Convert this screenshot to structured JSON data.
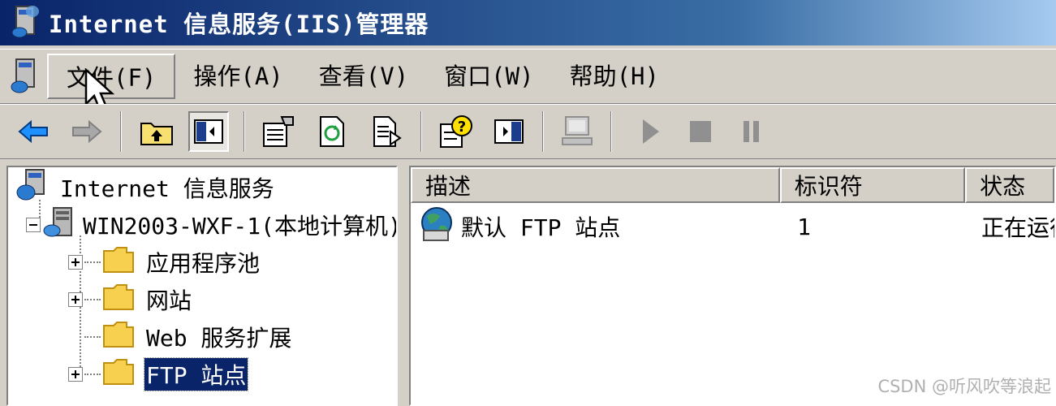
{
  "window": {
    "title": "Internet 信息服务(IIS)管理器",
    "icon": "iis-computer-icon"
  },
  "menu": {
    "items": [
      {
        "label": "文件(F)",
        "pressed": true
      },
      {
        "label": "操作(A)"
      },
      {
        "label": "查看(V)"
      },
      {
        "label": "窗口(W)"
      },
      {
        "label": "帮助(H)"
      }
    ]
  },
  "toolbar": {
    "buttons": [
      "back-arrow-icon",
      "forward-arrow-icon",
      "up-folder-icon",
      "show-hide-tree-icon",
      "properties-icon",
      "refresh-icon",
      "export-list-icon",
      "help-icon",
      "show-hide-action-pane-icon",
      "connect-computer-icon",
      "start-icon",
      "stop-icon",
      "pause-icon"
    ]
  },
  "tree": {
    "root": "Internet 信息服务",
    "computer": "WIN2003-WXF-1(本地计算机)",
    "children": [
      {
        "label": "应用程序池",
        "expandable": true
      },
      {
        "label": "网站",
        "expandable": true
      },
      {
        "label": "Web 服务扩展",
        "expandable": false
      },
      {
        "label": "FTP 站点",
        "expandable": true,
        "selected": true
      }
    ]
  },
  "list": {
    "columns": [
      "描述",
      "标识符",
      "状态"
    ],
    "rows": [
      {
        "description": "默认 FTP 站点",
        "identifier": "1",
        "status": "正在运行"
      }
    ]
  },
  "watermark": "CSDN @听风吹等浪起",
  "colors": {
    "titlebar_start": "#0a246a",
    "titlebar_end": "#a6caf0",
    "chrome": "#d4d0c8",
    "selection": "#0a246a"
  }
}
